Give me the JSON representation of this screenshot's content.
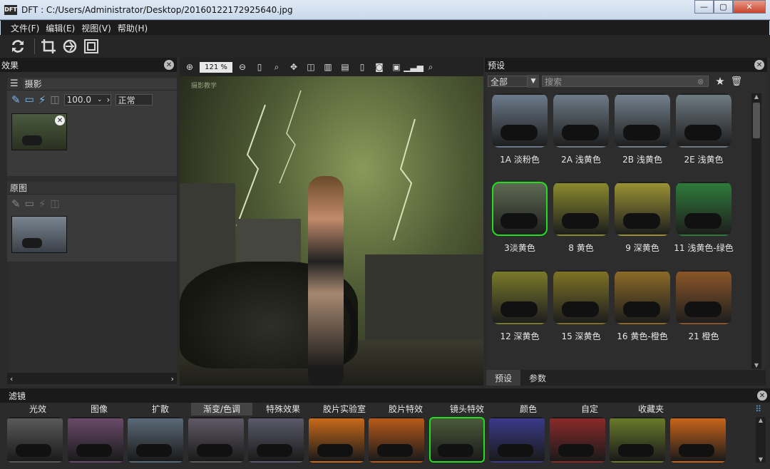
{
  "window": {
    "title": "DFT : C:/Users/Administrator/Desktop/20160122172925640.jpg",
    "logo": "DFT",
    "min": "—",
    "max": "▢",
    "close": "✕"
  },
  "menu": [
    "文件(F)",
    "编辑(E)",
    "视图(V)",
    "帮助(H)"
  ],
  "effects_panel": {
    "title": "效果",
    "layer_name": "摄影",
    "opacity": "100.0",
    "blend_mode": "正常",
    "original_label": "原图"
  },
  "canvas": {
    "zoom": "121 %",
    "watermark": "摄影教学"
  },
  "presets_panel": {
    "title": "预设",
    "category": "全部",
    "search_placeholder": "搜索",
    "items": [
      {
        "label": "1A 淡粉色",
        "tint": "#6b7a8a"
      },
      {
        "label": "2A 浅黄色",
        "tint": "#6d7a86"
      },
      {
        "label": "2B 浅黄色",
        "tint": "#72808c"
      },
      {
        "label": "2E 浅黄色",
        "tint": "#6e7a82"
      },
      {
        "label": "3淡黄色",
        "tint": "#5e6a52",
        "selected": true
      },
      {
        "label": "8 黄色",
        "tint": "#8a8a2e"
      },
      {
        "label": "9 深黄色",
        "tint": "#9a9234"
      },
      {
        "label": "11 浅黄色-绿色",
        "tint": "#2e7a3a"
      },
      {
        "label": "12 深黄色",
        "tint": "#7a7a2a"
      },
      {
        "label": "15 深黄色",
        "tint": "#7e7224"
      },
      {
        "label": "16 黄色-橙色",
        "tint": "#8a6a26"
      },
      {
        "label": "21 橙色",
        "tint": "#8a5628"
      }
    ],
    "tabs": [
      "预设",
      "参数"
    ]
  },
  "filters_panel": {
    "title": "滤镜",
    "tabs": [
      "光效",
      "图像",
      "扩散",
      "渐变/色调",
      "特殊效果",
      "胶片实验室",
      "胶片特效",
      "镜头特效",
      "颜色",
      "自定",
      "收藏夹"
    ],
    "active_tab": 3,
    "thumbs": [
      {
        "tint": "#5a5a5a"
      },
      {
        "tint": "#6a4a6a"
      },
      {
        "tint": "#5a6a78"
      },
      {
        "tint": "#605a66"
      },
      {
        "tint": "#5a5a6a"
      },
      {
        "tint": "#c86a1a"
      },
      {
        "tint": "#b85a1a"
      },
      {
        "tint": "#4a5a3a",
        "selected": true
      },
      {
        "tint": "#3a3a8a"
      },
      {
        "tint": "#8a2a2a"
      },
      {
        "tint": "#6a7a2a"
      },
      {
        "tint": "#c8641a"
      }
    ]
  }
}
